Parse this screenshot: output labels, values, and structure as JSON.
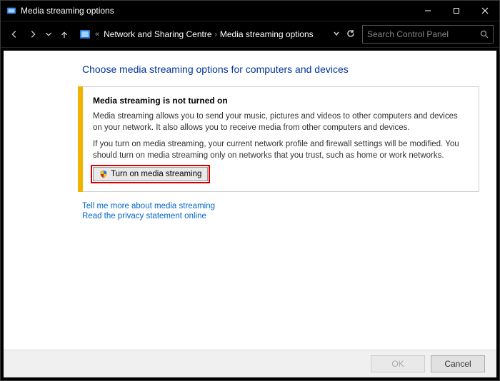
{
  "window": {
    "title": "Media streaming options"
  },
  "nav": {
    "breadcrumb": {
      "part1": "Network and Sharing Centre",
      "part2": "Media streaming options"
    },
    "search_placeholder": "Search Control Panel"
  },
  "page": {
    "heading": "Choose media streaming options for computers and devices",
    "panel": {
      "title": "Media streaming is not turned on",
      "para1": "Media streaming allows you to send your music, pictures and videos to other computers and devices on your network.  It also allows you to receive media from other computers and devices.",
      "para2": "If you turn on media streaming, your current network profile and firewall settings will be modified. You should turn on media streaming only on networks that you trust, such as home or work networks.",
      "button_label": "Turn on media streaming"
    },
    "links": {
      "more": "Tell me more about media streaming",
      "privacy": "Read the privacy statement online"
    }
  },
  "footer": {
    "ok": "OK",
    "cancel": "Cancel"
  }
}
